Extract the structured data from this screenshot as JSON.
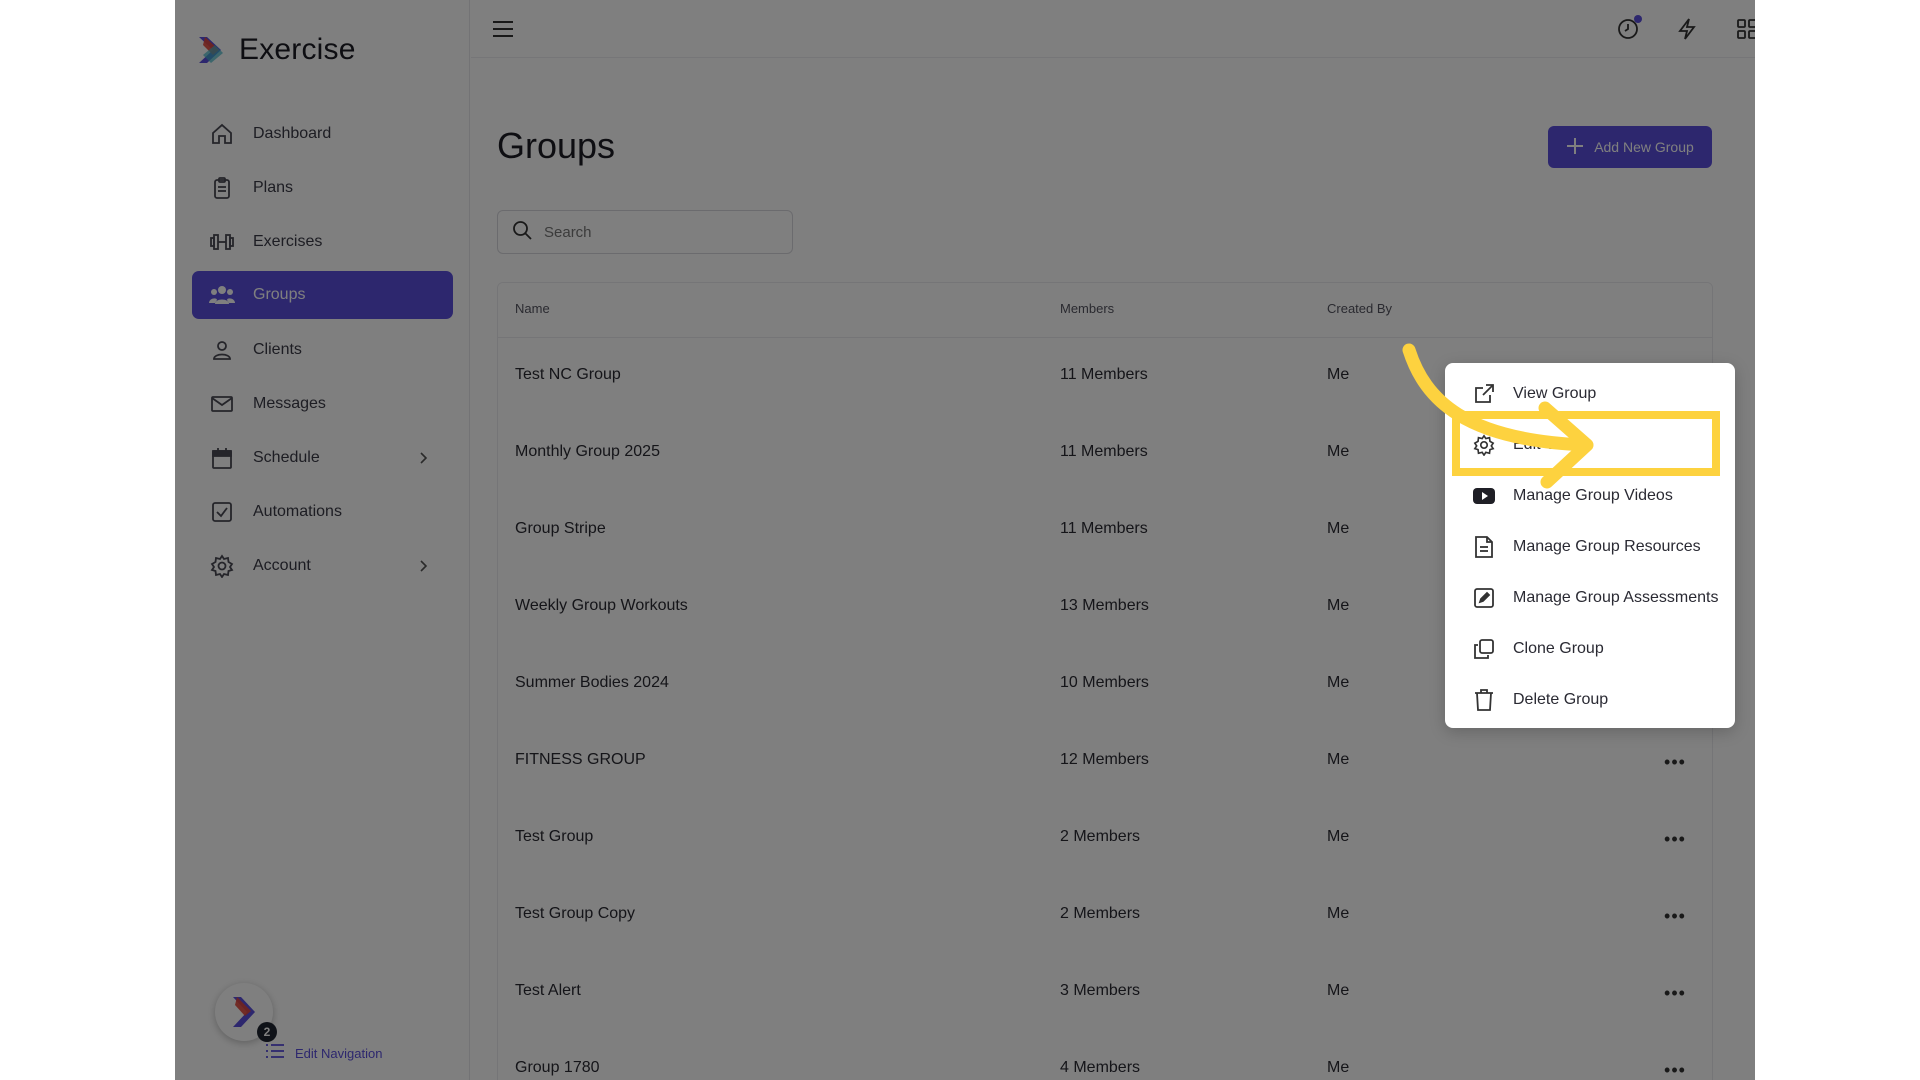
{
  "app": {
    "name": "Exercise"
  },
  "sidebar": {
    "items": [
      {
        "label": "Dashboard",
        "icon": "home-icon"
      },
      {
        "label": "Plans",
        "icon": "clipboard-icon"
      },
      {
        "label": "Exercises",
        "icon": "dumbbell-icon"
      },
      {
        "label": "Groups",
        "icon": "users-icon",
        "active": true
      },
      {
        "label": "Clients",
        "icon": "user-icon"
      },
      {
        "label": "Messages",
        "icon": "mail-icon"
      },
      {
        "label": "Schedule",
        "icon": "calendar-icon",
        "expandable": true
      },
      {
        "label": "Automations",
        "icon": "checkbox-icon"
      },
      {
        "label": "Account",
        "icon": "gear-icon",
        "expandable": true
      }
    ],
    "helper_badge": "2",
    "edit_navigation": "Edit Navigation"
  },
  "page": {
    "title": "Groups",
    "add_button": "Add New Group",
    "search_placeholder": "Search"
  },
  "table": {
    "columns": [
      "Name",
      "Members",
      "Created By"
    ],
    "rows": [
      {
        "name": "Test NC Group",
        "members": "11 Members",
        "created_by": "Me"
      },
      {
        "name": "Monthly Group 2025",
        "members": "11 Members",
        "created_by": "Me"
      },
      {
        "name": "Group Stripe",
        "members": "11 Members",
        "created_by": "Me"
      },
      {
        "name": "Weekly Group Workouts",
        "members": "13 Members",
        "created_by": "Me"
      },
      {
        "name": "Summer Bodies 2024",
        "members": "10 Members",
        "created_by": "Me"
      },
      {
        "name": "FITNESS GROUP",
        "members": "12 Members",
        "created_by": "Me"
      },
      {
        "name": "Test Group",
        "members": "2 Members",
        "created_by": "Me"
      },
      {
        "name": "Test Group Copy",
        "members": "2 Members",
        "created_by": "Me"
      },
      {
        "name": "Test Alert",
        "members": "3 Members",
        "created_by": "Me"
      },
      {
        "name": "Group 1780",
        "members": "4 Members",
        "created_by": "Me"
      }
    ]
  },
  "menu": {
    "items": [
      {
        "label": "View Group",
        "icon": "external-link-icon"
      },
      {
        "label": "Edit Group",
        "icon": "gear-icon",
        "highlighted": true
      },
      {
        "label": "Manage Group Videos",
        "icon": "youtube-icon"
      },
      {
        "label": "Manage Group Resources",
        "icon": "document-icon"
      },
      {
        "label": "Manage Group Assessments",
        "icon": "edit-square-icon"
      },
      {
        "label": "Clone Group",
        "icon": "copy-icon"
      },
      {
        "label": "Delete Group",
        "icon": "trash-icon"
      }
    ]
  },
  "colors": {
    "accent": "#5b4fdc",
    "highlight": "#fdd23f",
    "overlay": "rgba(0,0,0,0.5)"
  }
}
